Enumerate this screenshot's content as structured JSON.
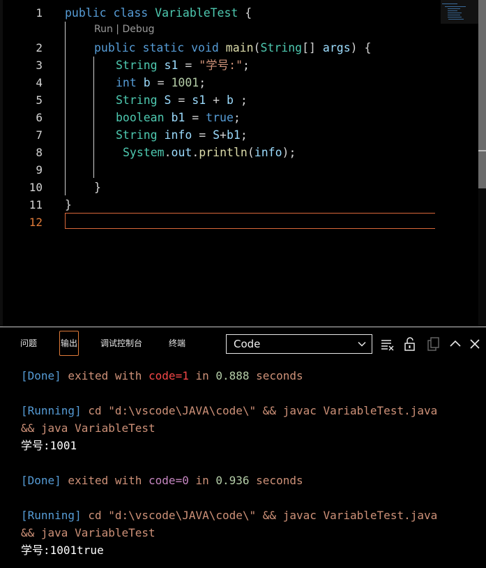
{
  "editor": {
    "codelens": {
      "run": "Run",
      "sep": " | ",
      "debug": "Debug"
    },
    "current_line": 12,
    "lines": [
      {
        "n": "1",
        "tokens": [
          [
            "kw",
            "public"
          ],
          [
            "pl",
            " "
          ],
          [
            "kw",
            "class"
          ],
          [
            "pl",
            " "
          ],
          [
            "ty",
            "VariableTest"
          ],
          [
            "pl",
            " {"
          ]
        ]
      },
      {
        "n": "2",
        "tokens": [
          [
            "kw",
            "public"
          ],
          [
            "pl",
            " "
          ],
          [
            "kw",
            "static"
          ],
          [
            "pl",
            " "
          ],
          [
            "kw",
            "void"
          ],
          [
            "pl",
            " "
          ],
          [
            "fn",
            "main"
          ],
          [
            "pl",
            "("
          ],
          [
            "ty",
            "String"
          ],
          [
            "pl",
            "[] "
          ],
          [
            "va",
            "args"
          ],
          [
            "pl",
            ") {"
          ]
        ]
      },
      {
        "n": "3",
        "tokens": [
          [
            "ty",
            "String"
          ],
          [
            "pl",
            " "
          ],
          [
            "va",
            "s1"
          ],
          [
            "pl",
            " = "
          ],
          [
            "st",
            "\"学号:\""
          ],
          [
            "pl",
            ";"
          ]
        ]
      },
      {
        "n": "4",
        "tokens": [
          [
            "kw",
            "int"
          ],
          [
            "pl",
            " "
          ],
          [
            "va",
            "b"
          ],
          [
            "pl",
            " = "
          ],
          [
            "nu",
            "1001"
          ],
          [
            "pl",
            ";"
          ]
        ]
      },
      {
        "n": "5",
        "tokens": [
          [
            "ty",
            "String"
          ],
          [
            "pl",
            " "
          ],
          [
            "va",
            "S"
          ],
          [
            "pl",
            " = "
          ],
          [
            "va",
            "s1"
          ],
          [
            "pl",
            " + "
          ],
          [
            "va",
            "b"
          ],
          [
            "pl",
            " ;"
          ]
        ]
      },
      {
        "n": "6",
        "tokens": [
          [
            "ty",
            "boolean"
          ],
          [
            "pl",
            " "
          ],
          [
            "va",
            "b1"
          ],
          [
            "pl",
            " = "
          ],
          [
            "kw",
            "true"
          ],
          [
            "pl",
            ";"
          ]
        ]
      },
      {
        "n": "7",
        "tokens": [
          [
            "ty",
            "String"
          ],
          [
            "pl",
            " "
          ],
          [
            "va",
            "info"
          ],
          [
            "pl",
            " = "
          ],
          [
            "va",
            "S"
          ],
          [
            "pl",
            "+"
          ],
          [
            "va",
            "b1"
          ],
          [
            "pl",
            ";"
          ]
        ]
      },
      {
        "n": "8",
        "tokens": [
          [
            "ty",
            "System"
          ],
          [
            "pl",
            "."
          ],
          [
            "va",
            "out"
          ],
          [
            "pl",
            "."
          ],
          [
            "fn",
            "println"
          ],
          [
            "pl",
            "("
          ],
          [
            "va",
            "info"
          ],
          [
            "pl",
            ");"
          ]
        ]
      },
      {
        "n": "9",
        "tokens": []
      },
      {
        "n": "10",
        "tokens": [
          [
            "pl",
            "}"
          ]
        ]
      },
      {
        "n": "11",
        "tokens": [
          [
            "pl",
            "}"
          ]
        ]
      },
      {
        "n": "12",
        "tokens": []
      }
    ]
  },
  "panel": {
    "tabs": [
      {
        "label": "问题",
        "active": false
      },
      {
        "label": "输出",
        "active": true
      },
      {
        "label": "调试控制台",
        "active": false
      },
      {
        "label": "终端",
        "active": false
      }
    ],
    "output_channel": "Code",
    "toolbar_icons": [
      "clear-output-icon",
      "lock-scroll-icon",
      "open-log-file-icon",
      "maximize-panel-icon",
      "close-panel-icon"
    ],
    "output_lines": [
      [
        [
          "c-blue",
          "[Done]"
        ],
        [
          "c-orange",
          " exited with "
        ],
        [
          "c-red",
          "code=1"
        ],
        [
          "c-orange",
          " in "
        ],
        [
          "c-green",
          "0.888"
        ],
        [
          "c-orange",
          " seconds"
        ]
      ],
      [],
      [
        [
          "c-blue",
          "[Running]"
        ],
        [
          "c-orange",
          " cd \"d:\\vscode\\JAVA\\code\\\" && javac VariableTest.java"
        ]
      ],
      [
        [
          "c-orange",
          "&& java VariableTest"
        ]
      ],
      [
        [
          "c-white",
          "学号:1001"
        ]
      ],
      [],
      [
        [
          "c-blue",
          "[Done]"
        ],
        [
          "c-orange",
          " exited with "
        ],
        [
          "c-violet",
          "code=0"
        ],
        [
          "c-orange",
          " in "
        ],
        [
          "c-green",
          "0.936"
        ],
        [
          "c-orange",
          " seconds"
        ]
      ],
      [],
      [
        [
          "c-blue",
          "[Running]"
        ],
        [
          "c-orange",
          " cd \"d:\\vscode\\JAVA\\code\\\" && javac VariableTest.java"
        ]
      ],
      [
        [
          "c-orange",
          "&& java VariableTest"
        ]
      ],
      [
        [
          "c-white",
          "学号:1001true"
        ]
      ]
    ]
  },
  "colors": {
    "background": "#000000",
    "accent": "#e07b39",
    "keyword": "#569cd6",
    "type": "#4ec9b0",
    "function": "#dcdcaa",
    "variable": "#9cdcfe",
    "string": "#ce9178",
    "number": "#b5cea8"
  }
}
